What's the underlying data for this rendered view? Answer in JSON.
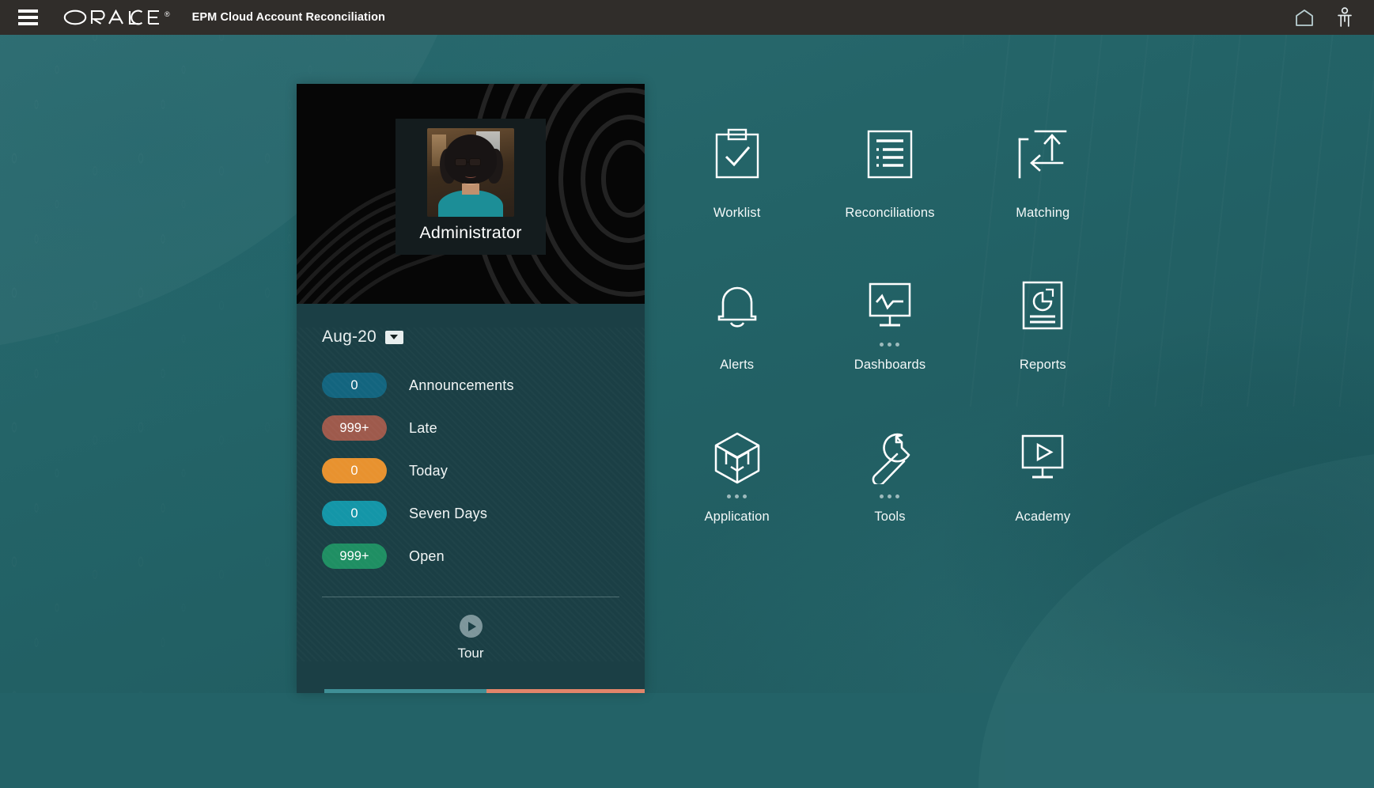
{
  "header": {
    "menu_icon": "hamburger-menu-icon",
    "brand": "ORACLE",
    "brand_registered": "®",
    "app_title": "EPM Cloud Account Reconciliation",
    "home_icon": "home-icon",
    "user_icon": "user-icon"
  },
  "user_card": {
    "avatar_image": "administrator-avatar-photo",
    "user_name": "Administrator",
    "period": {
      "label": "Aug-20",
      "caret_icon": "chevron-down-icon"
    },
    "badges": [
      {
        "count": "0",
        "label": "Announcements",
        "color": "#13657f"
      },
      {
        "count": "999+",
        "label": "Late",
        "color": "#9e5a4c"
      },
      {
        "count": "0",
        "label": "Today",
        "color": "#e8922f"
      },
      {
        "count": "0",
        "label": "Seven Days",
        "color": "#1496a8"
      },
      {
        "count": "999+",
        "label": "Open",
        "color": "#1f8f63"
      }
    ],
    "tour": {
      "label": "Tour",
      "icon": "play-circle-icon"
    },
    "progress_colors": [
      "#3f8f96",
      "#e0856a"
    ]
  },
  "tiles": [
    {
      "label": "Worklist",
      "icon": "clipboard-check-icon",
      "has_dots": false
    },
    {
      "label": "Reconciliations",
      "icon": "document-list-icon",
      "has_dots": false
    },
    {
      "label": "Matching",
      "icon": "matching-arrows-icon",
      "has_dots": false
    },
    {
      "label": "Alerts",
      "icon": "bell-icon",
      "has_dots": false
    },
    {
      "label": "Dashboards",
      "icon": "monitor-chart-icon",
      "has_dots": true
    },
    {
      "label": "Reports",
      "icon": "report-pie-icon",
      "has_dots": false
    },
    {
      "label": "Application",
      "icon": "cube-icon",
      "has_dots": true
    },
    {
      "label": "Tools",
      "icon": "wrench-icon",
      "has_dots": true
    },
    {
      "label": "Academy",
      "icon": "monitor-play-icon",
      "has_dots": false
    }
  ],
  "theme": {
    "background": "#236267",
    "header_bg": "#302d2a",
    "card_bg": "#1b3f45",
    "avatar_panel_bg": "#060606"
  }
}
